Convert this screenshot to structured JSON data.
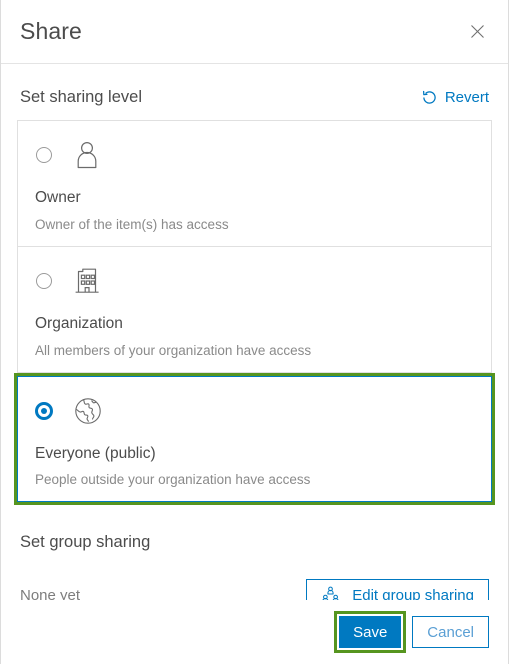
{
  "dialog": {
    "title": "Share",
    "close_icon": "close-icon"
  },
  "sharing_level": {
    "section_title": "Set sharing level",
    "revert_label": "Revert",
    "revert_icon": "revert-icon",
    "options": [
      {
        "icon": "person-icon",
        "label": "Owner",
        "description": "Owner of the item(s) has access",
        "selected": false,
        "highlighted": false
      },
      {
        "icon": "building-icon",
        "label": "Organization",
        "description": "All members of your organization have access",
        "selected": false,
        "highlighted": false
      },
      {
        "icon": "globe-icon",
        "label": "Everyone (public)",
        "description": "People outside your organization have access",
        "selected": true,
        "highlighted": true
      }
    ]
  },
  "group_sharing": {
    "section_title": "Set group sharing",
    "none_text": "None yet",
    "edit_button_label": "Edit group sharing",
    "edit_button_icon": "group-people-icon"
  },
  "footer": {
    "save_label": "Save",
    "cancel_label": "Cancel"
  },
  "colors": {
    "accent_blue": "#0079c1",
    "highlight_green": "#56951f",
    "text_primary": "#4c4c4c",
    "text_secondary": "#8a8a8a",
    "border_gray": "#e0e0e0"
  }
}
